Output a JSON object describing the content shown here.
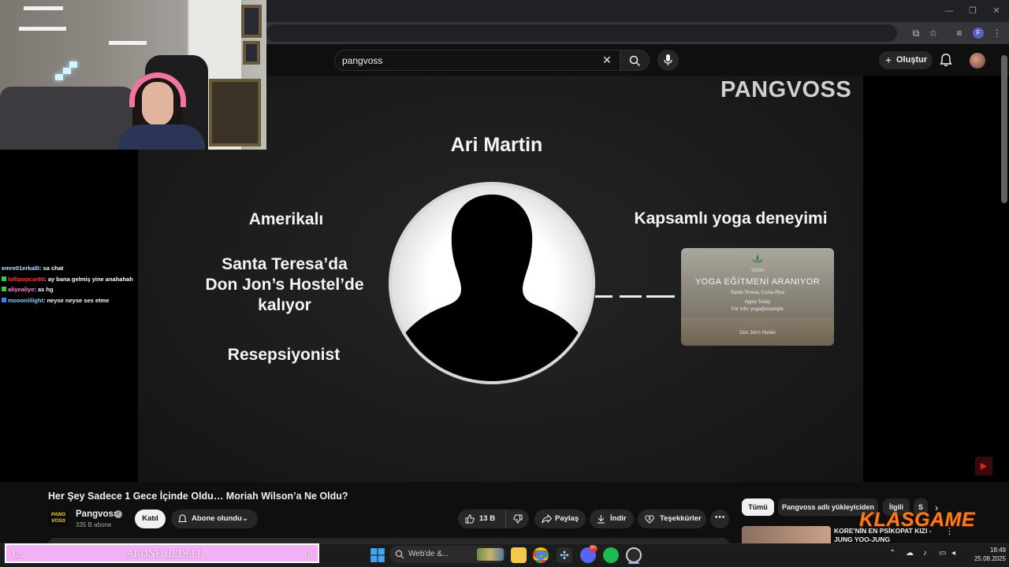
{
  "browser": {
    "window_controls": [
      "—",
      "❐",
      "✕"
    ],
    "profile_letter": "F"
  },
  "youtube": {
    "search": {
      "value": "pangvoss"
    },
    "create_label": "Oluştur"
  },
  "video": {
    "brand_watermark": "PANGVOSS",
    "person_name": "Ari Martin",
    "left_facts": [
      "Amerikalı",
      "Santa Teresa’da",
      "Don Jon’s Hostel’de",
      "kalıyor",
      "Resepsiyonist"
    ],
    "right_fact": "Kapsamlı yoga deneyimi",
    "yoga_card": {
      "logo_text": "YOGA",
      "headline": "YOGA EĞİTMENİ ARANIYOR",
      "sub1": "Santa Teresa, Costa Rica",
      "sub2": "Apply Today",
      "sub3": "For Info: yoga@example",
      "sub4": "Don Jon's Hostel"
    }
  },
  "chat": [
    {
      "user": "emre01erkal0",
      "message": ": sa chat",
      "color": "#b9e0ff",
      "badge": ""
    },
    {
      "user": "lollipopcar66",
      "message": ": ay bana gelmiş yine anahahah",
      "color": "#ff3b3b",
      "badge": "#2ecc40"
    },
    {
      "user": "aliyealiye",
      "message": ": as hg",
      "color": "#ff8ad8",
      "badge": "#2ecc40"
    },
    {
      "user": "mooonlilight",
      "message": ": neyse neyse ses etme",
      "color": "#7fd0ff",
      "badge": "#3b82f6"
    }
  ],
  "below": {
    "title": "Her Şey Sadece 1 Gece İçinde Oldu… Moriah Wilson’a Ne Oldu?",
    "channel": {
      "logo_text": "PANG VOSS",
      "name": "Pangvoss",
      "subs": "335 B abone",
      "verified": "✓"
    },
    "join_label": "Katıl",
    "subscribed_label": "Abone olundu",
    "like_count": "13 B",
    "share_label": "Paylaş",
    "download_label": "İndir",
    "thanks_label": "Teşekkürler",
    "more_label": "⋯"
  },
  "sidebar": {
    "chips": [
      "Tümü",
      "Pangvoss adlı yükleyiciden",
      "İlgili",
      "S"
    ],
    "rec_title": "KORE'NİN EN PSİKOPAT KIZI - JUNG YOO-JUNG"
  },
  "overlay_brand": "KLASGAME",
  "sub_goal": {
    "current": "12",
    "label": "ABONE HEDEFİ",
    "target": "8"
  },
  "taskbar": {
    "search_placeholder": "Web'de &...",
    "discord_badge": "9+",
    "time": "18:49",
    "date": "25.08.2025"
  }
}
